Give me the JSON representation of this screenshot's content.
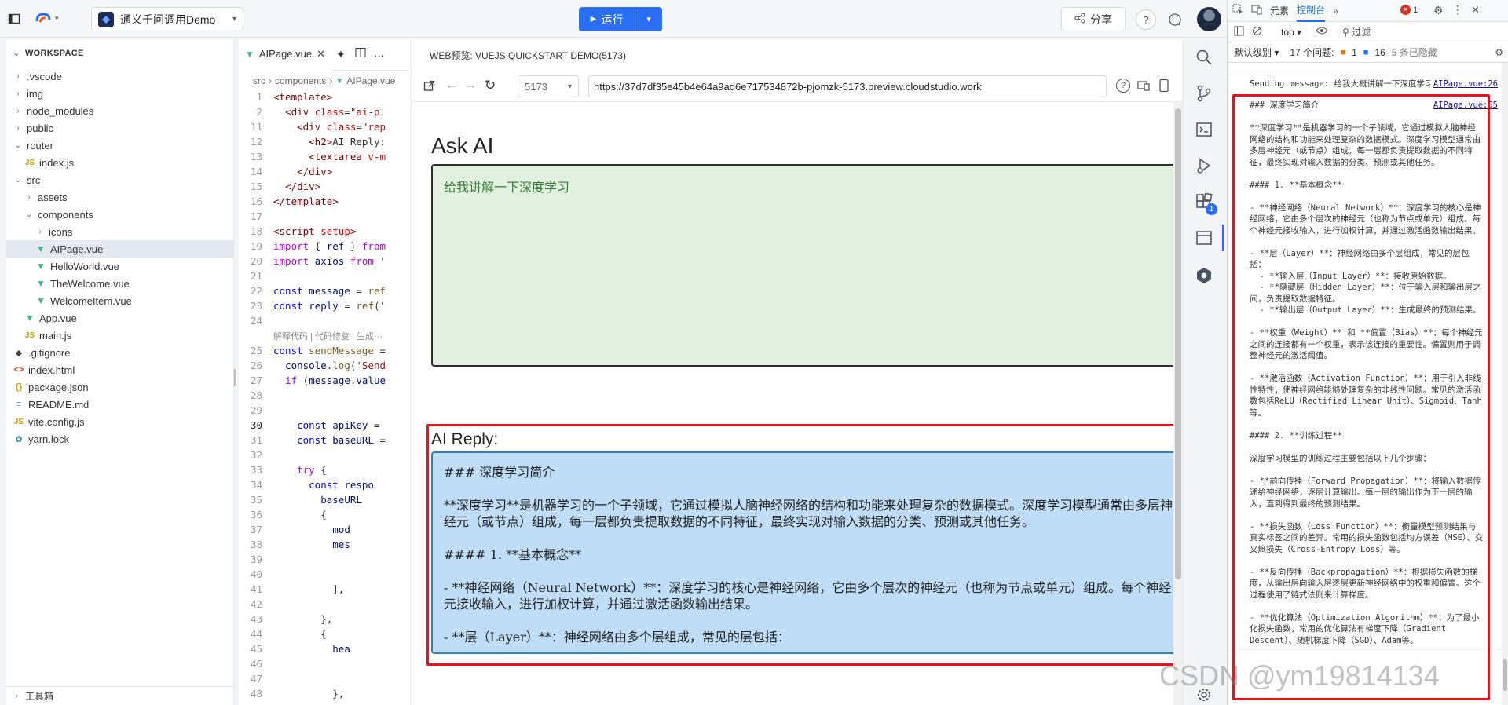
{
  "topbar": {
    "project_name": "通义千问调用Demo",
    "run_label": "运行",
    "share_label": "分享"
  },
  "explorer": {
    "title": "WORKSPACE",
    "items": [
      {
        "label": ".vscode",
        "type": "folder",
        "depth": 0,
        "open": false
      },
      {
        "label": "img",
        "type": "folder",
        "depth": 0,
        "open": false
      },
      {
        "label": "node_modules",
        "type": "folder",
        "depth": 0,
        "open": false
      },
      {
        "label": "public",
        "type": "folder",
        "depth": 0,
        "open": false
      },
      {
        "label": "router",
        "type": "folder",
        "depth": 0,
        "open": true
      },
      {
        "label": "index.js",
        "type": "js",
        "depth": 1
      },
      {
        "label": "src",
        "type": "folder",
        "depth": 0,
        "open": true
      },
      {
        "label": "assets",
        "type": "folder",
        "depth": 1,
        "open": false
      },
      {
        "label": "components",
        "type": "folder",
        "depth": 1,
        "open": true
      },
      {
        "label": "icons",
        "type": "folder",
        "depth": 2,
        "open": false
      },
      {
        "label": "AIPage.vue",
        "type": "vue",
        "depth": 2,
        "selected": true
      },
      {
        "label": "HelloWorld.vue",
        "type": "vue",
        "depth": 2
      },
      {
        "label": "TheWelcome.vue",
        "type": "vue",
        "depth": 2
      },
      {
        "label": "WelcomeItem.vue",
        "type": "vue",
        "depth": 2
      },
      {
        "label": "App.vue",
        "type": "vue",
        "depth": 1
      },
      {
        "label": "main.js",
        "type": "js",
        "depth": 1
      },
      {
        "label": ".gitignore",
        "type": "git",
        "depth": 0
      },
      {
        "label": "index.html",
        "type": "html",
        "depth": 0
      },
      {
        "label": "package.json",
        "type": "json",
        "depth": 0
      },
      {
        "label": "README.md",
        "type": "md",
        "depth": 0
      },
      {
        "label": "vite.config.js",
        "type": "js",
        "depth": 0
      },
      {
        "label": "yarn.lock",
        "type": "yarn",
        "depth": 0
      }
    ],
    "bottom_label": "工具箱"
  },
  "editor": {
    "tab_label": "AIPage.vue",
    "breadcrumb": [
      "src",
      "components",
      "AIPage.vue"
    ],
    "hint": "解释代码 | 代码修复 | 生成···",
    "lines": [
      {
        "n": "1",
        "html": "<span class='tag'>&lt;template&gt;</span>"
      },
      {
        "n": "2",
        "html": "  <span class='tag'>&lt;div</span> <span class='attr'>class</span>=<span class='str'>\"ai-p</span>"
      },
      {
        "n": "11",
        "html": "    <span class='tag'>&lt;div</span> <span class='attr'>class</span>=<span class='str'>\"rep</span>"
      },
      {
        "n": "12",
        "html": "      <span class='tag'>&lt;h2&gt;</span>AI Reply:"
      },
      {
        "n": "13",
        "html": "      <span class='tag'>&lt;textarea</span> <span class='attr'>v-m</span>"
      },
      {
        "n": "14",
        "html": "    <span class='tag'>&lt;/div&gt;</span>"
      },
      {
        "n": "15",
        "html": "  <span class='tag'>&lt;/div&gt;</span>"
      },
      {
        "n": "16",
        "html": "<span class='tag'>&lt;/template&gt;</span>"
      },
      {
        "n": "17",
        "html": ""
      },
      {
        "n": "18",
        "html": "<span class='tag'>&lt;script</span> <span class='attr'>setup</span><span class='tag'>&gt;</span>"
      },
      {
        "n": "19",
        "html": "<span class='kw2'>import</span> { <span class='var'>ref</span> } <span class='kw2'>from</span>"
      },
      {
        "n": "20",
        "html": "<span class='kw2'>import</span> <span class='var'>axios</span> <span class='kw2'>from</span> <span class='str'>'</span>"
      },
      {
        "n": "21",
        "html": ""
      },
      {
        "n": "22",
        "html": "<span class='kw'>const</span> <span class='var'>message</span> = <span class='fn'>ref</span>"
      },
      {
        "n": "23",
        "html": "<span class='kw'>const</span> <span class='var'>reply</span> = <span class='fn'>ref</span>(<span class='str'>'</span>"
      },
      {
        "n": "24",
        "html": ""
      },
      {
        "n": "",
        "html": "HINT"
      },
      {
        "n": "25",
        "html": "<span class='kw'>const</span> <span class='fn'>sendMessage</span> ="
      },
      {
        "n": "26",
        "html": "  <span class='var'>console</span>.<span class='fn'>log</span>(<span class='str'>'Send</span>"
      },
      {
        "n": "27",
        "html": "  <span class='kw2'>if</span> (<span class='var'>message</span>.<span class='var'>value</span>"
      },
      {
        "n": "28",
        "html": ""
      },
      {
        "n": "29",
        "html": ""
      },
      {
        "n": "30",
        "html": "    <span class='kw'>const</span> <span class='var'>apiKey</span> =",
        "current": true
      },
      {
        "n": "31",
        "html": "    <span class='kw'>const</span> <span class='var'>baseURL</span> ="
      },
      {
        "n": "32",
        "html": ""
      },
      {
        "n": "33",
        "html": "    <span class='kw2'>try</span> {"
      },
      {
        "n": "34",
        "html": "      <span class='kw'>const</span> <span class='var'>respo</span>"
      },
      {
        "n": "35",
        "html": "        <span class='var'>baseURL</span>"
      },
      {
        "n": "36",
        "html": "        {"
      },
      {
        "n": "37",
        "html": "          <span class='var'>mod</span>"
      },
      {
        "n": "38",
        "html": "          <span class='var'>mes</span>"
      },
      {
        "n": "39",
        "html": ""
      },
      {
        "n": "40",
        "html": ""
      },
      {
        "n": "41",
        "html": "          ],"
      },
      {
        "n": "42",
        "html": ""
      },
      {
        "n": "43",
        "html": "        },"
      },
      {
        "n": "44",
        "html": "        {"
      },
      {
        "n": "45",
        "html": "          <span class='var'>hea</span>"
      },
      {
        "n": "46",
        "html": ""
      },
      {
        "n": "47",
        "html": ""
      },
      {
        "n": "48",
        "html": "          },"
      }
    ]
  },
  "preview": {
    "title": "WEB预览: VUEJS QUICKSTART DEMO(5173)",
    "port": "5173",
    "url": "https://37d7df35e45b4e64a9ad6e717534872b-pjomzk-5173.preview.cloudstudio.work",
    "ask_heading": "Ask AI",
    "ask_text": "给我讲解一下深度学习",
    "reply_heading": "AI Reply:",
    "reply_paragraphs": [
      "### 深度学习简介",
      "**深度学习**是机器学习的一个子领域，它通过模拟人脑神经网络的结构和功能来处理复杂的数据模式。深度学习模型通常由多层神经元（或节点）组成，每一层都负责提取数据的不同特征，最终实现对输入数据的分类、预测或其他任务。",
      "#### 1. **基本概念**",
      "- **神经网络（Neural Network）**：深度学习的核心是神经网络，它由多个层次的神经元（也称为节点或单元）组成。每个神经元接收输入，进行加权计算，并通过激活函数输出结果。",
      "- **层（Layer）**：神经网络由多个层组成，常见的层包括："
    ]
  },
  "devtools": {
    "tabs": [
      "元素",
      "控制台"
    ],
    "active_tab": "控制台",
    "context": "top",
    "filter_placeholder": "过滤",
    "level": "默认级别",
    "issues_label": "17 个问题:",
    "issue_err": "1",
    "issue_info": "16",
    "hidden": "5 条已隐藏",
    "err_count": "1",
    "logs": [
      {
        "text": "Sending message: 给我大概讲解一下深度学习",
        "link": "AIPage.vue:26"
      }
    ],
    "reply_link": "AIPage.vue:55",
    "reply_text": "### 深度学习简介\n\n**深度学习**是机器学习的一个子领域，它通过模拟人脑神经网络的结构和功能来处理复杂的数据模式。深度学习模型通常由多层神经元（或节点）组成，每一层都负责提取数据的不同特征，最终实现对输入数据的分类、预测或其他任务。\n\n#### 1. **基本概念**\n\n- **神经网络（Neural Network）**：深度学习的核心是神经网络，它由多个层次的神经元（也称为节点或单元）组成。每个神经元接收输入，进行加权计算，并通过激活函数输出结果。\n\n- **层（Layer）**：神经网络由多个层组成，常见的层包括：\n  - **输入层（Input Layer）**：接收原始数据。\n  - **隐藏层（Hidden Layer）**：位于输入层和输出层之间，负责提取数据特征。\n  - **输出层（Output Layer）**：生成最终的预测结果。\n\n- **权重（Weight）** 和 **偏置（Bias）**：每个神经元之间的连接都有一个权重，表示该连接的重要性。偏置则用于调整神经元的激活阈值。\n\n- **激活函数（Activation Function）**：用于引入非线性特性，使神经网络能够处理复杂的非线性问题。常见的激活函数包括ReLU（Rectified Linear Unit）、Sigmoid、Tanh等。\n\n#### 2. **训练过程**\n\n深度学习模型的训练过程主要包括以下几个步骤：\n\n- **前向传播（Forward Propagation）**：将输入数据传递给神经网络，逐层计算输出。每一层的输出作为下一层的输入，直到得到最终的预测结果。\n\n- **损失函数（Loss Function）**：衡量模型预测结果与真实标签之间的差异。常用的损失函数包括均方误差（MSE）、交叉熵损失（Cross-Entropy Loss）等。\n\n- **反向传播（Backpropagation）**：根据损失函数的梯度，从输出层向输入层逐层更新神经网络中的权重和偏置。这个过程使用了链式法则来计算梯度。\n\n- **优化算法（Optimization Algorithm）**：为了最小化损失函数，常用的优化算法有梯度下降（Gradient Descent）、随机梯度下降（SGD）、Adam等。"
  },
  "watermark": "CSDN @ym19814134"
}
